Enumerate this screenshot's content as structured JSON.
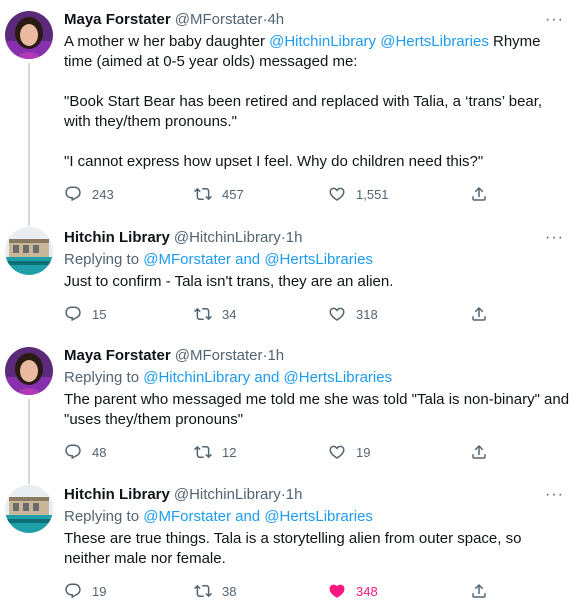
{
  "tweets": [
    {
      "name": "Maya Forstater",
      "handle": "@MForstater",
      "time": "4h",
      "text_parts": [
        "A mother w her baby daughter ",
        "@HitchinLibrary",
        " ",
        "@HertsLibraries",
        " Rhyme time (aimed at 0-5 year olds) messaged me:\n\n\"Book Start Bear has been retired and replaced with Talia, a ‘trans’ bear, with they/them pronouns.\"\n\n\"I cannot express how upset I feel. Why do children need this?\""
      ],
      "replies": "243",
      "retweets": "457",
      "likes": "1,551"
    },
    {
      "name": "Hitchin Library",
      "handle": "@HitchinLibrary",
      "time": "1h",
      "reply_prefix": "Replying to ",
      "reply_targets": "@MForstater and @HertsLibraries",
      "text": "Just to confirm - Tala isn't trans, they are an alien.",
      "replies": "15",
      "retweets": "34",
      "likes": "318"
    },
    {
      "name": "Maya Forstater",
      "handle": "@MForstater",
      "time": "1h",
      "reply_prefix": "Replying to ",
      "reply_targets": "@HitchinLibrary and @HertsLibraries",
      "text": "The parent who messaged me told me she was told \"Tala is non-binary\" and \"uses they/them pronouns\"",
      "replies": "48",
      "retweets": "12",
      "likes": "19"
    },
    {
      "name": "Hitchin Library",
      "handle": "@HitchinLibrary",
      "time": "1h",
      "reply_prefix": "Replying to ",
      "reply_targets": "@MForstater and @HertsLibraries",
      "text": "These are true things. Tala is a storytelling alien from outer space, so neither male nor female.",
      "replies": "19",
      "retweets": "38",
      "likes": "348"
    }
  ],
  "separator": " · ",
  "more_label": "···",
  "colors": {
    "link": "#1d9bf0",
    "muted": "#536471",
    "like_active": "#f91880"
  }
}
